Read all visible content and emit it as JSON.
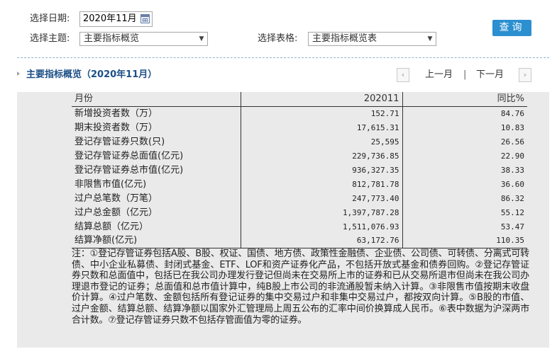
{
  "filters": {
    "date_label": "选择日期:",
    "date_value": "2020年11月",
    "theme_label": "选择主题:",
    "theme_value": "主要指标概览",
    "table_label": "选择表格:",
    "table_value": "主要指标概览表",
    "query_button": "查询"
  },
  "section": {
    "title": "主要指标概览（2020年11月）",
    "prev_label": "上一月",
    "separator": "|",
    "next_label": "下一月",
    "prev_arrow": "‹",
    "next_arrow": "›"
  },
  "table": {
    "headers": [
      "月份",
      "202011",
      "同比%"
    ],
    "rows": [
      {
        "label": "新增投资者数（万）",
        "value": "152.71",
        "yoy": "84.76"
      },
      {
        "label": "期末投资者数（万）",
        "value": "17,615.31",
        "yoy": "10.83"
      },
      {
        "label": "登记存管证券只数(只)",
        "value": "25,595",
        "yoy": "26.56"
      },
      {
        "label": "登记存管证券总面值(亿元)",
        "value": "229,736.85",
        "yoy": "22.90"
      },
      {
        "label": "登记存管证券总市值(亿元)",
        "value": "936,327.35",
        "yoy": "38.33"
      },
      {
        "label": "非限售市值(亿元)",
        "value": "812,781.78",
        "yoy": "36.60"
      },
      {
        "label": "过户总笔数（万笔）",
        "value": "247,773.40",
        "yoy": "86.32"
      },
      {
        "label": "过户总金额（亿元）",
        "value": "1,397,787.28",
        "yoy": "55.12"
      },
      {
        "label": "结算总额（亿元）",
        "value": "1,511,076.93",
        "yoy": "53.47"
      },
      {
        "label": "结算净额(亿元)",
        "value": "63,172.76",
        "yoy": "110.35"
      }
    ],
    "note": "注：①登记存管证券包括A股、B股、权证、国债、地方债、政策性金融债、企业债、公司债、可转债、分离式可转债、中小企业私募债、封闭式基金、ETF、LOF和资产证券化产品，不包括开放式基金和债券回购。②登记存管证券只数和总面值中，包括已在我公司办理发行登记但尚未在交易所上市的证券和已从交易所退市但尚未在我公司办理退市登记的证券；总面值和总市值计算中，纯B股上市公司的非流通股暂未纳入计算。③非限售市值按期末收盘价计算。④过户笔数、金额包括所有登记证券的集中交易过户和非集中交易过户，都按双向计算。⑤B股的市值、过户金额、结算总额、结算净额以国家外汇管理局上周五公布的汇率中间价换算成人民币。⑥表中数据为沪深两市合计数。⑦登记存管证券只数不包括存管面值为零的证券。"
  }
}
